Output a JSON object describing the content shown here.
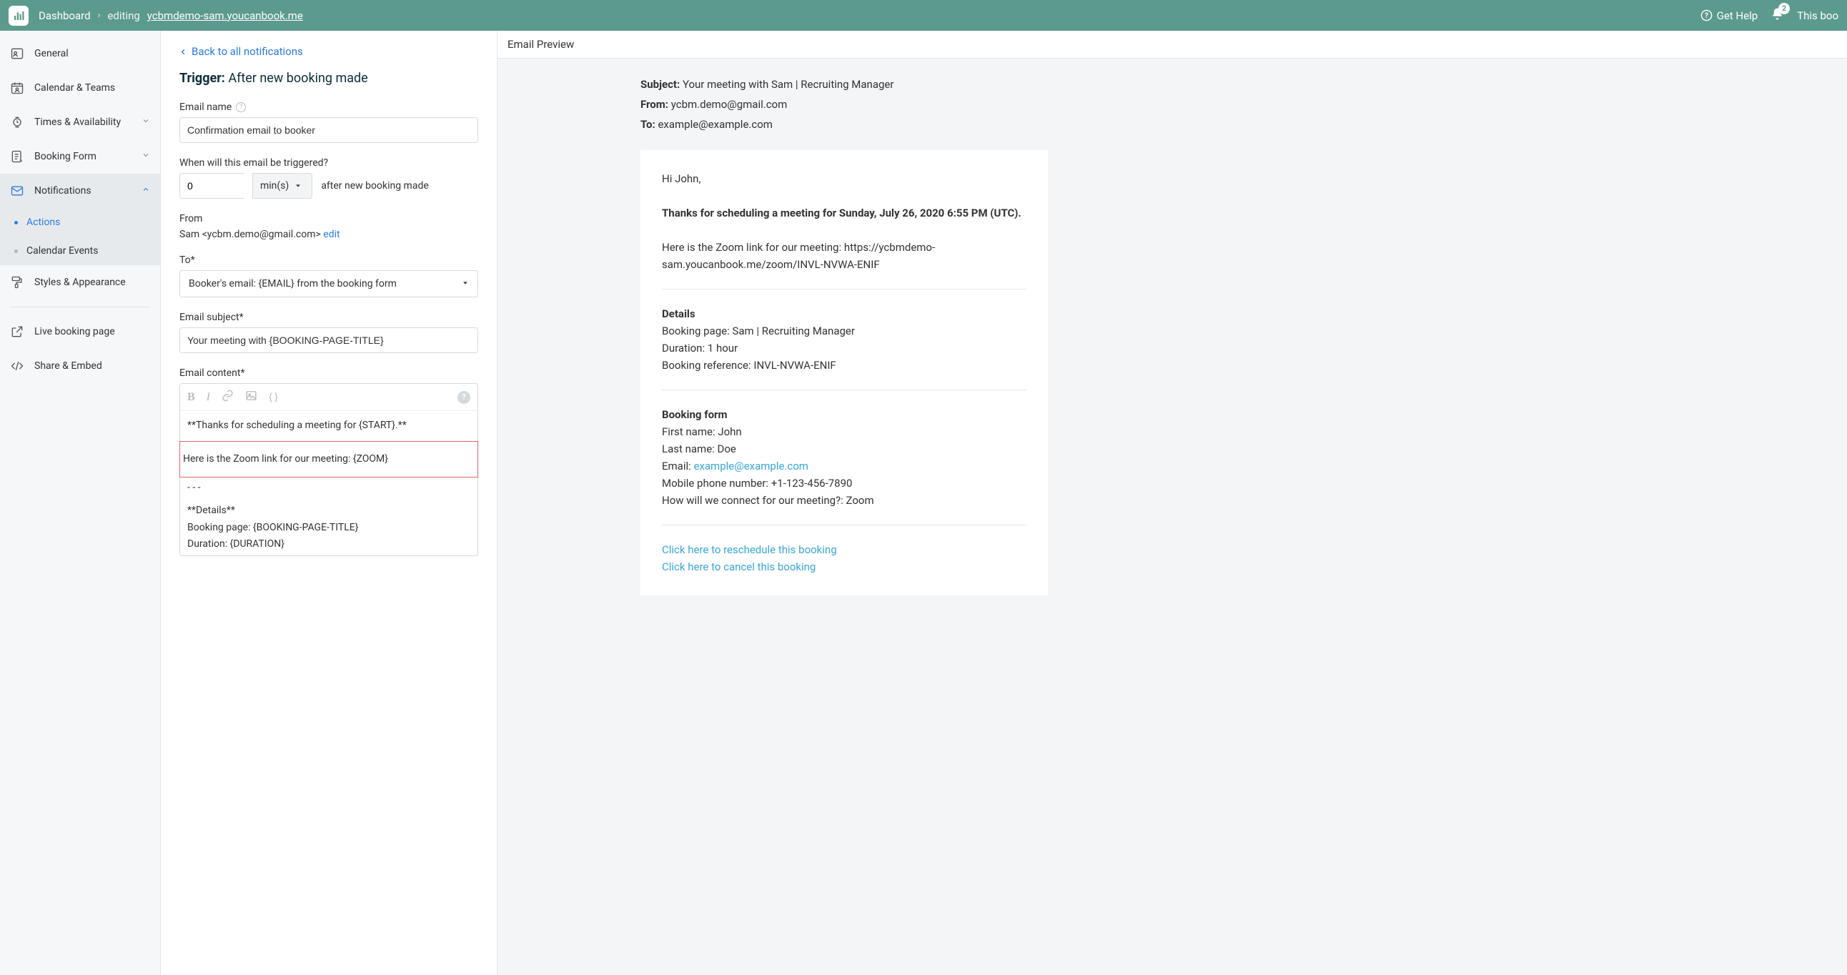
{
  "topbar": {
    "dashboard": "Dashboard",
    "editing": "editing",
    "url": "ycbmdemo-sam.youcanbook.me",
    "get_help": "Get Help",
    "notif_count": "2",
    "this_boo": "This boo"
  },
  "sidebar": {
    "general": "General",
    "calendar_teams": "Calendar & Teams",
    "times_avail": "Times & Availability",
    "booking_form": "Booking Form",
    "notifications": "Notifications",
    "actions": "Actions",
    "calendar_events": "Calendar Events",
    "styles": "Styles & Appearance",
    "live_page": "Live booking page",
    "share_embed": "Share & Embed"
  },
  "form": {
    "back": "Back to all notifications",
    "trigger_label": "Trigger:",
    "trigger_value": "After new booking made",
    "email_name_label": "Email name",
    "email_name_value": "Confirmation email to booker",
    "when_label": "When will this email be triggered?",
    "when_value": "0",
    "when_unit": "min(s)",
    "when_after": "after new booking made",
    "from_label": "From",
    "from_value": "Sam <ycbm.demo@gmail.com>",
    "edit": "edit",
    "to_label": "To*",
    "to_value": "Booker's email: {EMAIL} from the booking form",
    "subject_label": "Email subject*",
    "subject_value": "Your meeting with {BOOKING-PAGE-TITLE}",
    "content_label": "Email content*",
    "content_line1": "**Thanks for scheduling a meeting for {START}.**",
    "content_line2": "Here is the Zoom link for our meeting: {ZOOM}",
    "content_line3": "- - -",
    "content_line4": "**Details**",
    "content_line5": "Booking page: {BOOKING-PAGE-TITLE}",
    "content_line6": "Duration: {DURATION}"
  },
  "preview": {
    "title": "Email Preview",
    "subject_label": "Subject:",
    "subject": "Your meeting with Sam | Recruiting Manager",
    "from_label": "From:",
    "from": "ycbm.demo@gmail.com",
    "to_label": "To:",
    "to": "example@example.com",
    "hi": "Hi John,",
    "thanks": "Thanks for scheduling a meeting for Sunday, July 26, 2020 6:55 PM (UTC).",
    "zoom_line": "Here is the Zoom link for our meeting: https://ycbmdemo-sam.youcanbook.me/zoom/INVL-NVWA-ENIF",
    "details_heading": "Details",
    "details_page": "Booking page: Sam | Recruiting Manager",
    "details_duration": "Duration: 1 hour",
    "details_ref": "Booking reference: INVL-NVWA-ENIF",
    "form_heading": "Booking form",
    "form_first": "First name: John",
    "form_last": "Last name: Doe",
    "form_email_label": "Email: ",
    "form_email": "example@example.com",
    "form_phone": "Mobile phone number: +1-123-456-7890",
    "form_connect": "How will we connect for our meeting?: Zoom",
    "reschedule": "Click here to reschedule this booking",
    "cancel": "Click here to cancel this booking"
  }
}
